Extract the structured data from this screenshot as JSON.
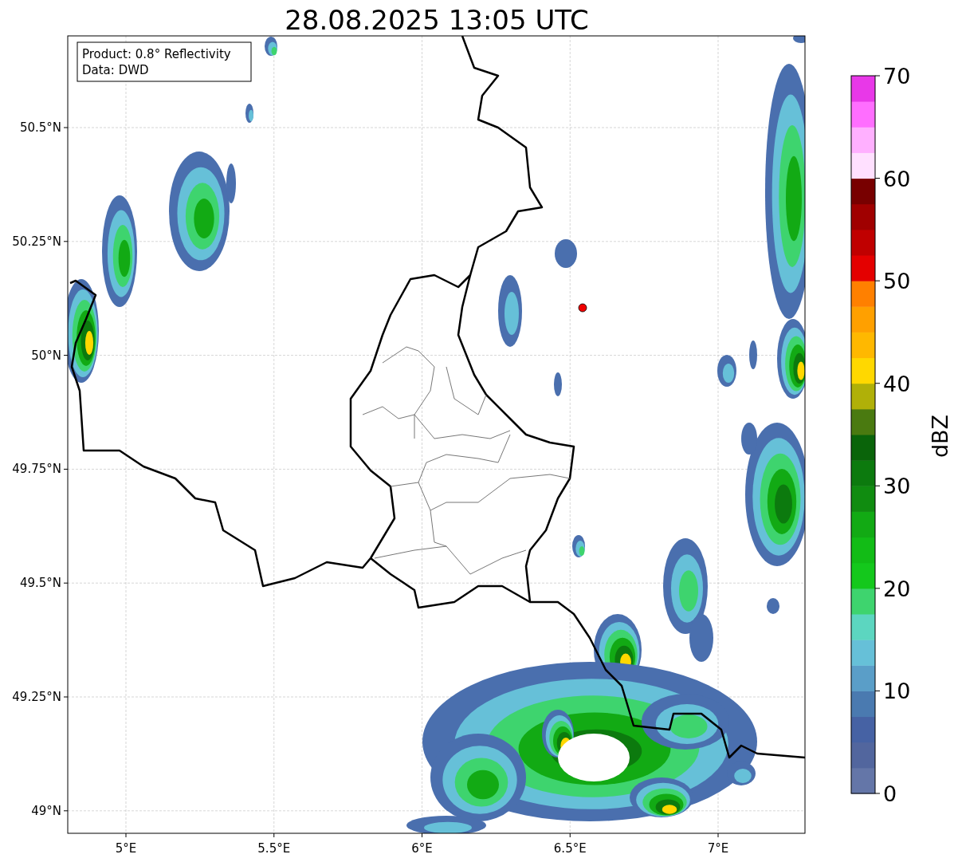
{
  "title": "28.08.2025 13:05 UTC",
  "legend": [
    "Product: 0.8° Reflectivity",
    "Data: DWD"
  ],
  "x_ticks": [
    "5°E",
    "5.5°E",
    "6°E",
    "6.5°E",
    "7°E"
  ],
  "y_ticks": [
    "50.5°N",
    "50.25°N",
    "50°N",
    "49.75°N",
    "49.5°N",
    "49.25°N",
    "49°N"
  ],
  "colorbar": {
    "label": "dBZ",
    "ticks": [
      "70",
      "60",
      "50",
      "40",
      "30",
      "20",
      "10",
      "0"
    ],
    "segments": [
      {
        "color": "#6476a8"
      },
      {
        "color": "#52669e"
      },
      {
        "color": "#4662a4"
      },
      {
        "color": "#4a7ab0"
      },
      {
        "color": "#5a9ec8"
      },
      {
        "color": "#66c0d8"
      },
      {
        "color": "#5cd6c0"
      },
      {
        "color": "#3ed46e"
      },
      {
        "color": "#14c81c"
      },
      {
        "color": "#12bc16"
      },
      {
        "color": "#12aa14"
      },
      {
        "color": "#108c10"
      },
      {
        "color": "#0c7a0e"
      },
      {
        "color": "#0a640a"
      },
      {
        "color": "#4a7a10"
      },
      {
        "color": "#b0b008"
      },
      {
        "color": "#ffd800"
      },
      {
        "color": "#ffb800"
      },
      {
        "color": "#ffa000"
      },
      {
        "color": "#ff8000"
      },
      {
        "color": "#e40000"
      },
      {
        "color": "#c00000"
      },
      {
        "color": "#a00000"
      },
      {
        "color": "#780000"
      },
      {
        "color": "#ffe0ff"
      },
      {
        "color": "#ffb0ff"
      },
      {
        "color": "#ff6eff"
      },
      {
        "color": "#e838e8"
      }
    ]
  }
}
